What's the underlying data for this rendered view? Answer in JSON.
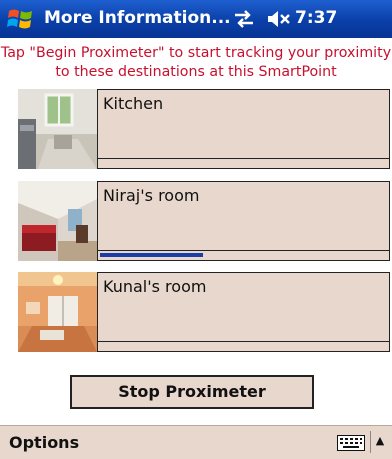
{
  "titlebar": {
    "title": "More Information...",
    "time": "7:37"
  },
  "instruction": "Tap \"Begin Proximeter\" to start tracking your proximity to these destinations at this SmartPoint",
  "destinations": [
    {
      "label": "Kitchen",
      "proximity": 0.0
    },
    {
      "label": "Niraj's room",
      "proximity": 0.36
    },
    {
      "label": "Kunal's room",
      "proximity": 0.0
    }
  ],
  "button": {
    "label": "Stop Proximeter"
  },
  "menubar": {
    "options_label": "Options",
    "sip_arrow": "▲"
  },
  "colors": {
    "titlebar": "#0a3fa8",
    "panel": "#e8d7cc",
    "instruction_text": "#c8102e",
    "progress_fill": "#1a3ea8"
  }
}
